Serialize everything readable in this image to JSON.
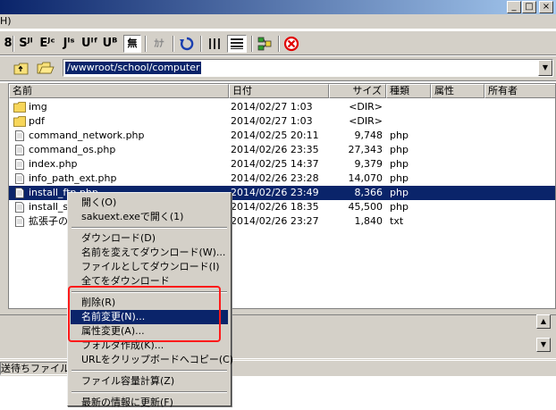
{
  "menubar": {
    "help_fragment": "H)"
  },
  "window_buttons": {
    "minimize": "_",
    "maximize": "□",
    "close": "×"
  },
  "toolbar": {
    "buttons": [
      {
        "label": "8",
        "name": "encoding-8-button"
      },
      {
        "label": "Sᴶᴵ",
        "name": "encoding-sjis-button"
      },
      {
        "label": "Eᴶᶜ",
        "name": "encoding-euc-button"
      },
      {
        "label": "Jᴵˢ",
        "name": "encoding-jis-button"
      },
      {
        "label": "Uᴵᶠ",
        "name": "encoding-utf8-button"
      },
      {
        "label": "Uᴮ",
        "name": "encoding-utf8bom-button"
      },
      {
        "label": "無",
        "name": "no-conversion-button"
      },
      {
        "label": "ｶﾅ",
        "name": "kana-button"
      }
    ],
    "icons": [
      "refresh-icon",
      "list-view-icon",
      "detail-view-icon",
      "sync-icon",
      "stop-icon"
    ]
  },
  "address": {
    "path": "/wwwroot/school/computer"
  },
  "columns": [
    "名前",
    "日付",
    "サイズ",
    "種類",
    "属性",
    "所有者"
  ],
  "files": [
    {
      "name": "img",
      "date": "2014/02/27 1:03",
      "size": "<DIR>",
      "type": "",
      "icon": "folder-icon"
    },
    {
      "name": "pdf",
      "date": "2014/02/27 1:03",
      "size": "<DIR>",
      "type": "",
      "icon": "folder-icon"
    },
    {
      "name": "command_network.php",
      "date": "2014/02/25 20:11",
      "size": "9,748",
      "type": "php",
      "icon": "file-icon"
    },
    {
      "name": "command_os.php",
      "date": "2014/02/26 23:35",
      "size": "27,343",
      "type": "php",
      "icon": "file-icon"
    },
    {
      "name": "index.php",
      "date": "2014/02/25 14:37",
      "size": "9,379",
      "php": "",
      "type": "php",
      "icon": "file-icon"
    },
    {
      "name": "info_path_ext.php",
      "date": "2014/02/26 23:28",
      "size": "14,070",
      "type": "php",
      "icon": "file-icon"
    },
    {
      "name": "install_ftp.php",
      "date": "2014/02/26 23:49",
      "size": "8,366",
      "type": "php",
      "icon": "file-icon"
    },
    {
      "name": "install_s",
      "date": "2014/02/26 18:35",
      "size": "45,500",
      "type": "php",
      "icon": "file-icon"
    },
    {
      "name": "拡張子の",
      "date": "2014/02/26 23:27",
      "size": "1,840",
      "type": "txt",
      "icon": "file-icon"
    }
  ],
  "selected_row": 6,
  "status": {
    "text": "送待ちファイル0"
  },
  "context_menu": {
    "items": [
      {
        "label": "開く(O)"
      },
      {
        "label": "sakuext.exeで開く(1)"
      },
      {
        "sep": true
      },
      {
        "label": "ダウンロード(D)"
      },
      {
        "label": "名前を変えてダウンロード(W)..."
      },
      {
        "label": "ファイルとしてダウンロード(I)"
      },
      {
        "label": "全てをダウンロード"
      },
      {
        "sep": true
      },
      {
        "label": "削除(R)"
      },
      {
        "label": "名前変更(N)..."
      },
      {
        "label": "属性変更(A)..."
      },
      {
        "label": "フォルダ作成(K)..."
      },
      {
        "label": "URLをクリップボードへコピー(C)"
      },
      {
        "sep": true
      },
      {
        "label": "ファイル容量計算(Z)"
      },
      {
        "sep": true
      },
      {
        "label": "最新の情報に更新(F)"
      }
    ],
    "highlighted_index": 9
  },
  "highlight_box_color": "#ff1a1a"
}
